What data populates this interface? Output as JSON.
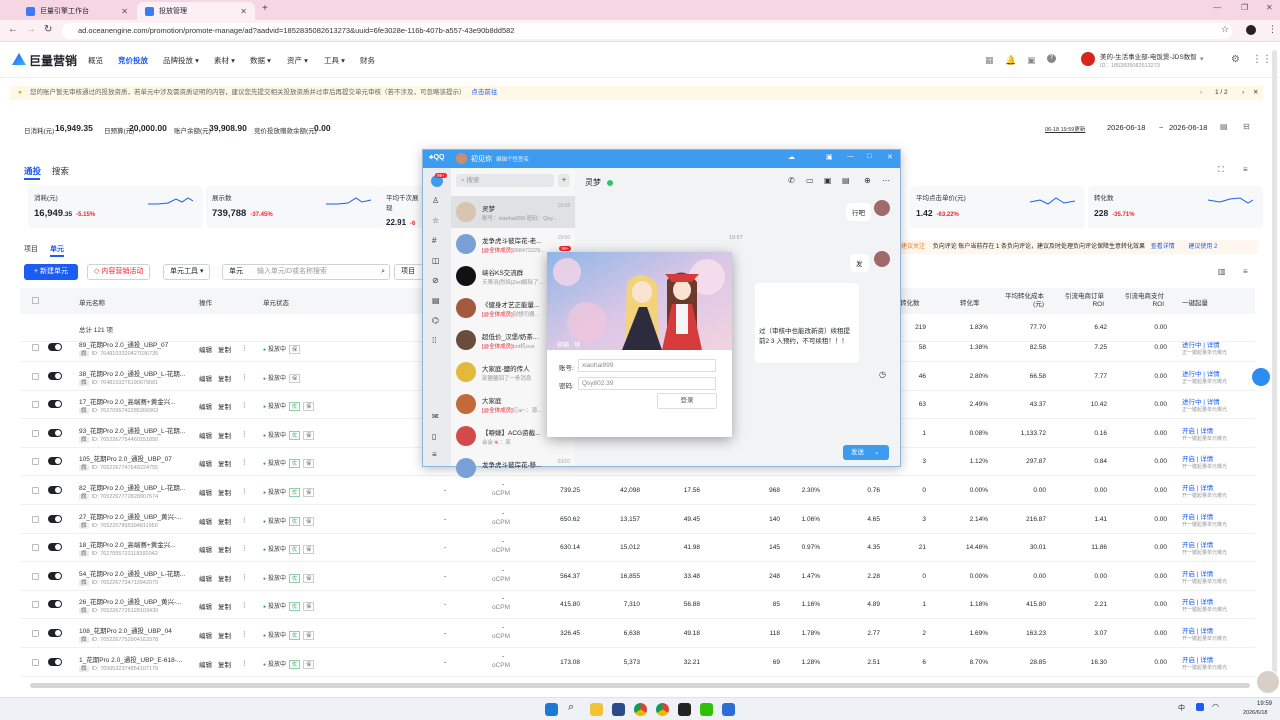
{
  "browser": {
    "tabs": [
      {
        "title": "巨量引擎工作台",
        "active": false
      },
      {
        "title": "投放管理",
        "active": true
      }
    ],
    "url": "ad.oceanengine.com/promotion/promote-manage/ad?aadvid=1852835082613273&uuid=6fe3028e-116b-407b-a557-43e90b8dd582"
  },
  "app": {
    "logo": "巨量营销",
    "nav": [
      "概览",
      "竞价投放",
      "品牌投放 ▾",
      "素材 ▾",
      "数据 ▾",
      "资产 ▾",
      "工具 ▾",
      "财务"
    ],
    "account_name": "美的-生活事业部-电饭煲-JDS数智",
    "account_id": "ID：1852835082613273",
    "notice": "您的账户暂无审核通过的投放资质，若单元中涉及需资质证明的内容，建议您先提交相关投放资质并过审后再提交单元审核（若不涉及，可忽略该提示）",
    "notice_link": "点击前往",
    "notice_page": "1 / 2"
  },
  "budget": {
    "spend_label": "日消耗(元)",
    "spend": "16,949.35",
    "budget_label": "日预算(元)",
    "budget": "20,000.00",
    "balance_label": "账户余额(元)",
    "balance": "39,908.90",
    "bid_balance_label": "竞价投放赠款余额(元)",
    "bid_balance": "0.00",
    "update_time": "06-18 19:59更新",
    "date_from": "2026-06-18",
    "date_sep": "~",
    "date_to": "2026-06-18"
  },
  "tabs": {
    "main": [
      "通投",
      "搜索"
    ],
    "sub": [
      "项目",
      "单元"
    ]
  },
  "metrics": [
    {
      "label": "消耗(元)",
      "value": "16,949",
      "decimals": ".35",
      "change": "-5.15%"
    },
    {
      "label": "展示数",
      "value": "739,788",
      "decimals": "",
      "change": "-37.45%"
    },
    {
      "label": "平均千次展现",
      "value": "22.91",
      "decimals": "",
      "change": "-6"
    },
    {
      "label": "平均点击单价(元)",
      "value": "1.42",
      "decimals": "",
      "change": "-63.22%"
    },
    {
      "label": "转化数",
      "value": "228",
      "decimals": "",
      "change": "-35.71%"
    }
  ],
  "toolbar": {
    "new_unit": "+ 新建单元",
    "marketing": "内容营销活动",
    "unit_tool": "单元工具 ▾",
    "search_type": "单元",
    "search_placeholder": "输入单元ID或名称搜索",
    "project_status": "项目状",
    "tip_label": "建议关注",
    "tip_text": "负向评论  账户当前存在 1 条负向评论，建议及时处理负向评论保障生意转化效果",
    "tip_link": "查看详情",
    "tip_button": "建议使用 2"
  },
  "table": {
    "headers": [
      "单元名称",
      "操作",
      "单元状态",
      "转化数",
      "转化率",
      "平均转化成本(元)",
      "引流电商订单ROI",
      "引流电商支付ROI",
      "一键起量"
    ],
    "total_label": "总计 121 项",
    "total_values": [
      "219",
      "1.83%",
      "77.70",
      "6.42",
      "0.00"
    ],
    "rows": [
      {
        "name": "89_花期Pro 2.0_通投_UBP_07",
        "id": "ID: 7648103320427036735",
        "v": [
          "58",
          "1.38%",
          "82.58",
          "7.25",
          "0.00"
        ],
        "open": "进行中 | 详情",
        "sub": "正一键起量单元曝光"
      },
      {
        "name": "38_花期Pro 2.0_通投_UBP_L-花期...",
        "id": "ID: 7648103276190679081",
        "v": [
          "46",
          "2.80%",
          "66.58",
          "7.77",
          "0.00"
        ],
        "open": "进行中 | 详情",
        "sub": "正一键起量单元曝光"
      },
      {
        "name": "17_花期Pro 2.0_高端赛+黄金兴...",
        "id": "ID: 7627055742285266963",
        "v": [
          "63",
          "2.49%",
          "43.37",
          "10.42",
          "0.00"
        ],
        "open": "进行中 | 详情",
        "sub": "正一键起量单元曝光"
      },
      {
        "name": "93_花期Pro 2.0_通投_UBP_L-花期...",
        "id": "ID: 7652267754460151850",
        "v": [
          "1",
          "0.08%",
          "1,133.72",
          "0.16",
          "0.00"
        ],
        "open": "开启 | 详情",
        "sub": "开一键起量单元曝光"
      },
      {
        "name": "105_花期Pro 2.0_通投_UBP_07",
        "id": "ID: 7652267747649224755",
        "v": [
          "3",
          "1.12%",
          "297.87",
          "0.84",
          "0.00"
        ],
        "open": "开启 | 详情",
        "sub": "开一键起量单元曝光"
      },
      {
        "name": "82_花期Pro 2.0_通投_UBP_L-花期...",
        "id": "ID: 7652267772828907574",
        "m": [
          "739.25",
          "42,098",
          "17.56",
          "968",
          "2.30%",
          "0.76"
        ],
        "v": [
          "0",
          "0.00%",
          "0.00",
          "0.00",
          "0.00"
        ],
        "open": "开启 | 详情",
        "sub": "开一键起量单元曝光"
      },
      {
        "name": "27_花期Pro 2.0_通投_UBP_黄兴-...",
        "id": "ID: 7652267895394811950",
        "m": [
          "650.62",
          "13,157",
          "49.45",
          "140",
          "1.06%",
          "4.65"
        ],
        "v": [
          "3",
          "2.14%",
          "216.87",
          "1.41",
          "0.00"
        ],
        "open": "开启 | 详情",
        "sub": "开一键起量单元曝光"
      },
      {
        "name": "18_花期Pro 2.0_高端赛+黄金兴...",
        "id": "ID: 7627055723118392042",
        "m": [
          "630.14",
          "15,012",
          "41.98",
          "145",
          "0.97%",
          "4.35"
        ],
        "v": [
          "21",
          "14.48%",
          "30.01",
          "11.86",
          "0.00"
        ],
        "open": "开启 | 详情",
        "sub": "开一键起量单元曝光"
      },
      {
        "name": "54_花期Pro 2.0_通投_UBP_L-花期...",
        "id": "ID: 7652267734713942070",
        "m": [
          "564.37",
          "16,855",
          "33.48",
          "248",
          "1.47%",
          "2.28"
        ],
        "v": [
          "0",
          "0.00%",
          "0.00",
          "0.00",
          "0.00"
        ],
        "open": "开启 | 详情",
        "sub": "开一键起量单元曝光"
      },
      {
        "name": "26_花期Pro 2.0_通投_UBP_黄兴-...",
        "id": "ID: 7652267726128103430",
        "m": [
          "415.80",
          "7,310",
          "56.88",
          "85",
          "1.16%",
          "4.89"
        ],
        "v": [
          "1",
          "1.18%",
          "415.80",
          "2.21",
          "0.00"
        ],
        "open": "开启 | 详情",
        "sub": "开一键起量单元曝光"
      },
      {
        "name": "108_花期Pro 2.0_通投_UBP_04",
        "id": "ID: 7652267752904163378",
        "m": [
          "326.45",
          "6,638",
          "49.18",
          "118",
          "1.78%",
          "2.77"
        ],
        "v": [
          "2",
          "1.69%",
          "163.23",
          "3.07",
          "0.00"
        ],
        "open": "开启 | 详情",
        "sub": "开一键起量单元曝光"
      },
      {
        "name": "1_花期Pro 2.0_通投_UBP_E-618-...",
        "id": "ID: 7650532374854107179",
        "m": [
          "173.08",
          "5,373",
          "32.21",
          "69",
          "1.28%",
          "2.51"
        ],
        "v": [
          "6",
          "8.70%",
          "28.85",
          "16.30",
          "0.00"
        ],
        "open": "开启 | 详情",
        "sub": "开一键起量单元曝光"
      }
    ],
    "ops": [
      "编辑",
      "复制",
      "⋮"
    ],
    "status": "投放中",
    "dash": "-",
    "ocpm": "oCPM"
  },
  "qq": {
    "title_user": "初见你",
    "title_sig": "编辑个性签名",
    "search": "搜索",
    "badge": "99+",
    "chat_name": "灵梦",
    "msg_right1": "行吧",
    "msg_time": "19:57",
    "msg_right2": "发",
    "msg_left": "过（审核中也能改新资）续租提前2 3 入预约，不可续租！！！",
    "send": "发送",
    "convs": [
      {
        "name": "灵梦",
        "msg": "账号：xiaohai999 密码：Qsy...",
        "time": "19:58"
      },
      {
        "name": "龙争虎斗彼岸花-老...",
        "msg": "[@全体成员]368473229...",
        "time": "19:56"
      },
      {
        "name": "峡谷KS交流群",
        "msg": "天蒂羽[烈焰]Zed解除了...",
        "time": ""
      },
      {
        "name": "《健身才艺正能量...",
        "msg": "[@全体成员]别想司搬...",
        "time": ""
      },
      {
        "name": "超低价_汉堡/奶茶...",
        "msg": "[@全体成员]bot机ous",
        "time": ""
      },
      {
        "name": "大家庭-鹽的传人",
        "msg": "部鹽鹽回了一条消息",
        "time": ""
      },
      {
        "name": "大家庭",
        "msg": "[@全体成员]亿ar~：源...",
        "time": ""
      },
      {
        "name": "【噼婕】ACG资截...",
        "msg": "会会🍬：笑",
        "time": ""
      },
      {
        "name": "龙争虎斗彼岸花-移...",
        "msg": "",
        "time": "03/10"
      }
    ],
    "conv_badge": "99+",
    "login": {
      "tabs": "邮箱 · 绑",
      "acct_label": "账号:",
      "acct": "xiaohai999",
      "pwd_label": "密码:",
      "pwd": "Qsy802.39",
      "button": "登录"
    }
  },
  "taskbar": {
    "time": "19:59",
    "date": "2026/6/18",
    "lang": "中"
  }
}
